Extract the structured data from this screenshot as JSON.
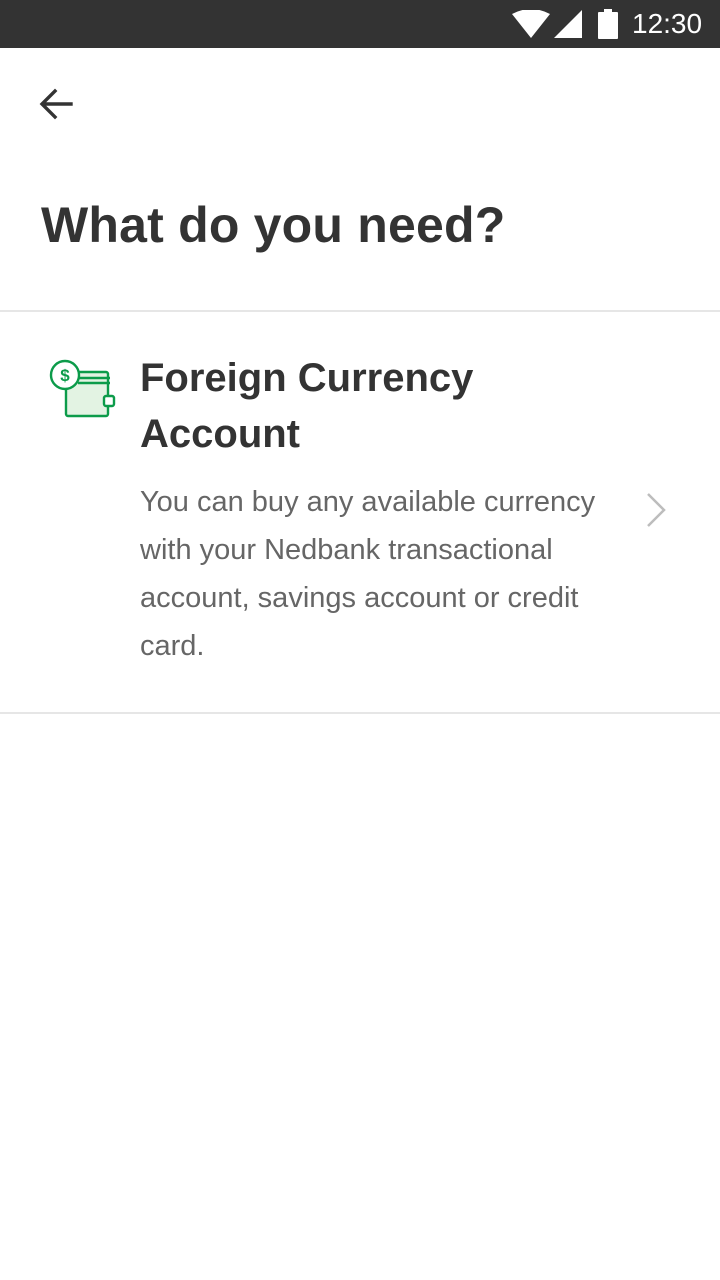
{
  "status_bar": {
    "time": "12:30",
    "icons": [
      "wifi-icon",
      "signal-icon",
      "battery-icon"
    ]
  },
  "header": {
    "back_icon": "arrow-left-icon",
    "title": "What do you need?"
  },
  "options": [
    {
      "icon": "wallet-dollar-icon",
      "title": "Foreign Currency Account",
      "description": "You can buy any available currency with your Nedbank transactional account, savings account or credit card.",
      "chevron_icon": "chevron-right-icon"
    }
  ],
  "colors": {
    "status_bar": "#333333",
    "accent_green": "#0c9b4a",
    "icon_fill": "#e3f3e3",
    "title_text": "#333333",
    "body_text": "#666666",
    "divider": "#e6e6e6"
  }
}
